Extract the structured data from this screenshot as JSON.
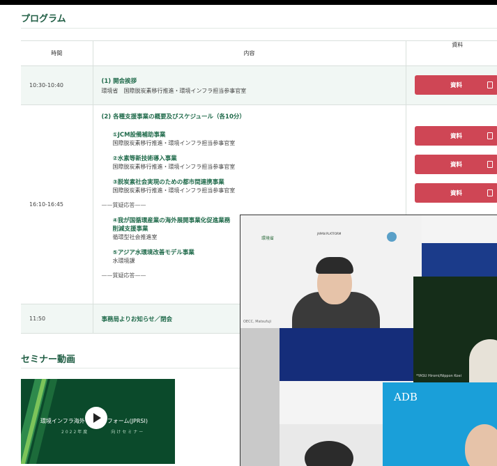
{
  "program": {
    "title": "プログラム",
    "headers": {
      "time": "時間",
      "content": "内容",
      "materials": "資料"
    },
    "rows": [
      {
        "time": "10:30-10:40",
        "title": "(1) 開会挨拶",
        "subtitle": "環境省　国際脱炭素移行推進・環境インフラ担当参事官室"
      },
      {
        "time": "16:10-16:45",
        "title": "(2) 各種支援事業の概要及びスケジュール（各10分）",
        "items": [
          {
            "title": "①JCM設備補助事業",
            "org": "国際脱炭素移行推進・環境インフラ担当参事官室"
          },
          {
            "title": "②水素等新技術導入事業",
            "org": "国際脱炭素移行推進・環境インフラ担当参事官室"
          },
          {
            "title": "③脱炭素社会実現のための都市間連携事業",
            "org": "国際脱炭素移行推進・環境インフラ担当参事官室"
          },
          {
            "title": "④我が国循環産業の海外展開事業化促進業務",
            "title2": "削減支援事業",
            "org": "循環型社会推進室"
          },
          {
            "title": "⑤アジア水環境改善モデル事業",
            "org": "水環境課"
          }
        ],
        "qa": "——質疑応答——"
      },
      {
        "time": "11:50",
        "title": "事務局よりお知らせ／閉会"
      }
    ],
    "material_label": "資料"
  },
  "seminar": {
    "title": "セミナー動画",
    "thumb_line1": "環境インフラ海外　　　　フォーム(JPRSI)",
    "thumb_line2": "2022年度　　　　向けセミナー"
  },
  "video": {
    "logo_left": "環境省",
    "logo_mid": "JAPAN PLATFORM",
    "caption1": "OECC, Matsufuji",
    "caption2": "*YASU Hiromi/Nippon Koei",
    "adb_text": "ADB"
  },
  "colors": {
    "accent": "#1f6a4a",
    "button": "#cf4655",
    "row_tint": "#f1f7f4"
  }
}
